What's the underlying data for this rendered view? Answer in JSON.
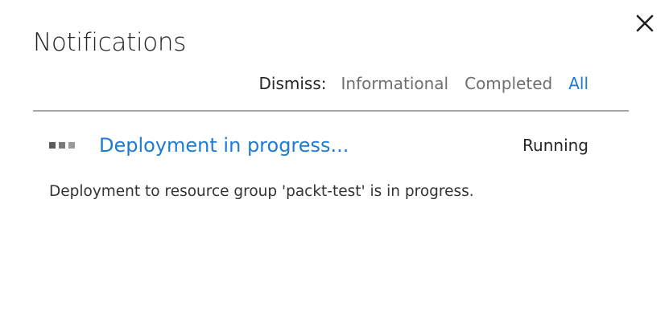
{
  "panel": {
    "title": "Notifications",
    "close_icon": "close-icon"
  },
  "dismiss": {
    "label": "Dismiss:",
    "options": [
      "Informational",
      "Completed",
      "All"
    ],
    "active_option": "All"
  },
  "notifications": [
    {
      "title": "Deployment in progress...",
      "status": "Running",
      "description": "Deployment to resource group 'packt-test' is in progress.",
      "icon": "progress-dots-icon"
    }
  ],
  "colors": {
    "link": "#1c7cd5",
    "muted_link": "#6e6e6e",
    "text": "#252525",
    "divider": "#a6a6a6",
    "dot_dark": "#5a5a5a",
    "dot_mid": "#7a7a7a",
    "dot_light": "#9a9a9a"
  }
}
